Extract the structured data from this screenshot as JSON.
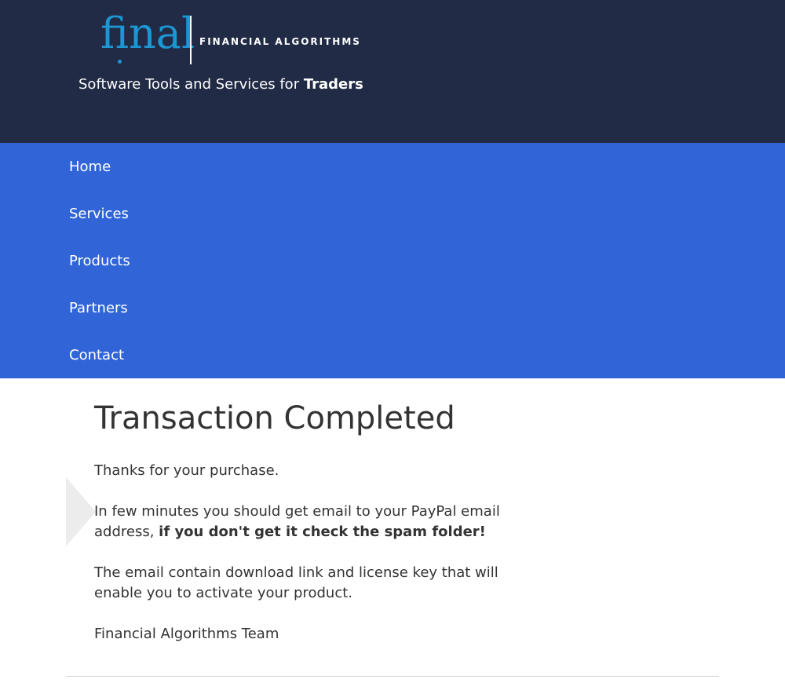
{
  "brand": {
    "logo_word": "final",
    "company": "FINANCIAL ALGORITHMS",
    "tagline_prefix": "Software Tools and Services for ",
    "tagline_bold": "Traders",
    "colors": {
      "header_bg": "#212b45",
      "logo_blue": "#1d96d3",
      "nav_bg": "#3165d7"
    }
  },
  "nav": {
    "items": [
      {
        "label": "Home"
      },
      {
        "label": "Services"
      },
      {
        "label": "Products"
      },
      {
        "label": "Partners"
      },
      {
        "label": "Contact"
      }
    ]
  },
  "main": {
    "title": "Transaction Completed",
    "thanks": "Thanks for your purchase.",
    "email_note_prefix": "In few minutes you should get email to your PayPal email address, ",
    "email_note_bold": "if you don't get it check the spam folder!",
    "download_note": "The email contain download link and license key that will enable you to activate your product.",
    "signature": "Financial Algorithms Team"
  }
}
